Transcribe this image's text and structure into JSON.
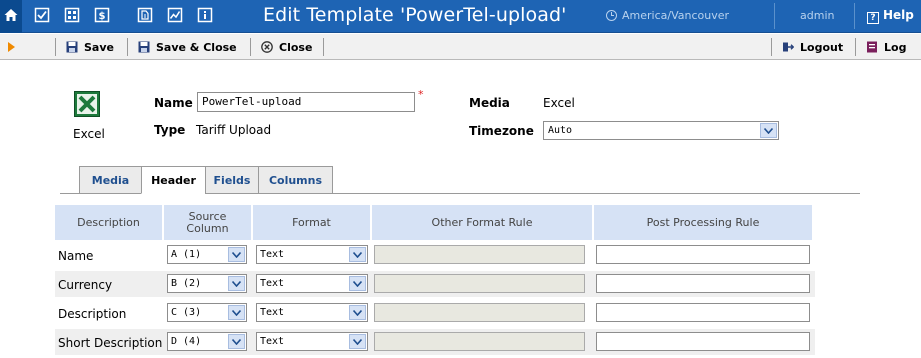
{
  "header": {
    "title": "Edit Template 'PowerTel-upload'",
    "timezone": "America/Vancouver",
    "user": "admin",
    "help_label": "Help"
  },
  "toolbar": {
    "save_label": "Save",
    "save_close_label": "Save & Close",
    "close_label": "Close",
    "logout_label": "Logout",
    "log_label": "Log"
  },
  "form": {
    "icon_caption": "Excel",
    "name_label": "Name",
    "name_value": "PowerTel-upload",
    "required_mark": "*",
    "type_label": "Type",
    "type_value": "Tariff Upload",
    "media_label": "Media",
    "media_value": "Excel",
    "timezone_label": "Timezone",
    "timezone_value": "Auto"
  },
  "tabs": [
    {
      "label": "Media"
    },
    {
      "label": "Header"
    },
    {
      "label": "Fields"
    },
    {
      "label": "Columns"
    }
  ],
  "active_tab": "Header",
  "table": {
    "headers": [
      "Description",
      "Source Column",
      "Format",
      "Other Format Rule",
      "Post Processing Rule"
    ],
    "rows": [
      {
        "description": "Name",
        "source": "A (1)",
        "format": "Text"
      },
      {
        "description": "Currency",
        "source": "B (2)",
        "format": "Text"
      },
      {
        "description": "Description",
        "source": "C (3)",
        "format": "Text"
      },
      {
        "description": "Short Description",
        "source": "D (4)",
        "format": "Text"
      }
    ]
  },
  "colors": {
    "header_bg": "#1e64b4",
    "toolbar_bg": "#f1f1f1",
    "table_header_bg": "#d6e2f5",
    "accent_orange": "#f08a00",
    "excel_green": "#1e7a3c"
  }
}
